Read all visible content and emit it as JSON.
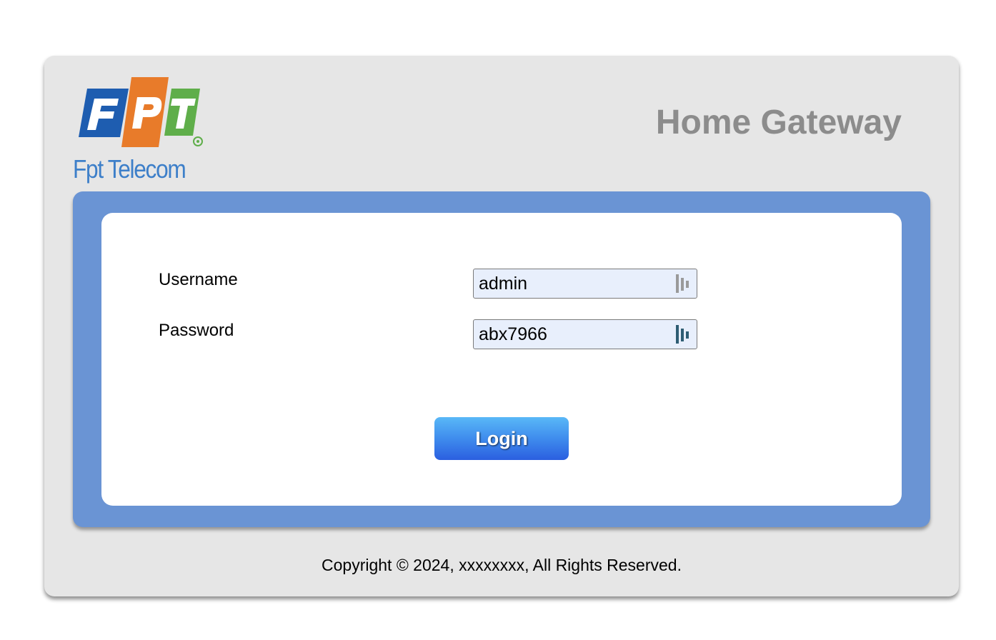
{
  "header": {
    "logo": {
      "tile_letters": [
        "F",
        "P",
        "T"
      ],
      "brand_text": "Fpt Telecom",
      "colors": {
        "tile_blue": "#1e5db0",
        "tile_orange": "#e87b2a",
        "tile_green": "#5fae4a",
        "text_blue": "#3d7fc9"
      }
    },
    "title": "Home Gateway"
  },
  "login_form": {
    "username_label": "Username",
    "username_value": "admin",
    "password_label": "Password",
    "password_value": "abx7966",
    "username_field_icon": "password-manager-icon",
    "password_field_icon": "password-manager-icon",
    "login_button_label": "Login"
  },
  "footer": {
    "copyright": "Copyright © 2024, xxxxxxxx, All Rights Reserved."
  },
  "colors": {
    "page_background": "#ffffff",
    "outer_panel": "#e6e6e6",
    "frame_blue": "#6a94d4",
    "input_background": "#e8effc",
    "button_gradient_top": "#59b8f7",
    "button_gradient_bottom": "#2b5fe0",
    "title_gray": "#8c8c8c"
  }
}
